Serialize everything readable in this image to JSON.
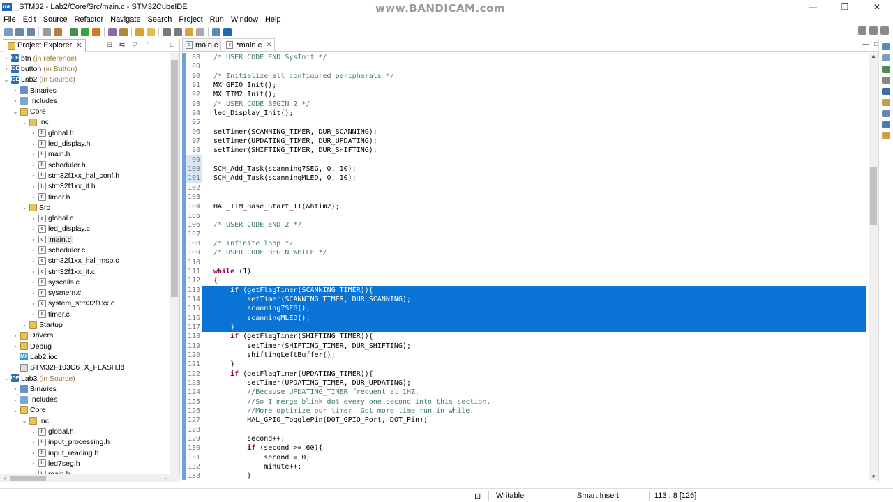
{
  "window": {
    "title": "_STM32 - Lab2/Core/Src/main.c - STM32CubeIDE",
    "logo_text": "IDE",
    "watermark": "www.BANDICAM.com",
    "minimize": "—",
    "maximize": "❐",
    "close": "✕"
  },
  "menu": [
    "File",
    "Edit",
    "Source",
    "Refactor",
    "Navigate",
    "Search",
    "Project",
    "Run",
    "Window",
    "Help"
  ],
  "explorer": {
    "title": "Project Explorer",
    "tree": [
      {
        "label": "btn",
        "suffix": "(in reference)",
        "icon": "project",
        "twisty": ">",
        "depth": 0
      },
      {
        "label": "button",
        "suffix": "(in Button)",
        "icon": "project",
        "twisty": ">",
        "depth": 0
      },
      {
        "label": "Lab2",
        "suffix": "(in Source)",
        "icon": "project",
        "twisty": "v",
        "depth": 0
      },
      {
        "label": "Binaries",
        "suffix": "",
        "icon": "bin",
        "twisty": ">",
        "depth": 1
      },
      {
        "label": "Includes",
        "suffix": "",
        "icon": "inc",
        "twisty": ">",
        "depth": 1
      },
      {
        "label": "Core",
        "suffix": "",
        "icon": "srcfolder",
        "twisty": "v",
        "depth": 1
      },
      {
        "label": "Inc",
        "suffix": "",
        "icon": "folder",
        "twisty": "v",
        "depth": 2
      },
      {
        "label": "global.h",
        "suffix": "",
        "icon": "file",
        "twisty": ">",
        "depth": 3
      },
      {
        "label": "led_display.h",
        "suffix": "",
        "icon": "file",
        "twisty": ">",
        "depth": 3
      },
      {
        "label": "main.h",
        "suffix": "",
        "icon": "file",
        "twisty": ">",
        "depth": 3
      },
      {
        "label": "scheduler.h",
        "suffix": "",
        "icon": "file",
        "twisty": ">",
        "depth": 3
      },
      {
        "label": "stm32f1xx_hal_conf.h",
        "suffix": "",
        "icon": "file",
        "twisty": ">",
        "depth": 3
      },
      {
        "label": "stm32f1xx_it.h",
        "suffix": "",
        "icon": "file",
        "twisty": ">",
        "depth": 3
      },
      {
        "label": "timer.h",
        "suffix": "",
        "icon": "file",
        "twisty": ">",
        "depth": 3
      },
      {
        "label": "Src",
        "suffix": "",
        "icon": "folder",
        "twisty": "v",
        "depth": 2
      },
      {
        "label": "global.c",
        "suffix": "",
        "icon": "file",
        "twisty": ">",
        "depth": 3
      },
      {
        "label": "led_display.c",
        "suffix": "",
        "icon": "file",
        "twisty": ">",
        "depth": 3
      },
      {
        "label": "main.c",
        "suffix": "",
        "icon": "file",
        "twisty": ">",
        "depth": 3,
        "selected": true
      },
      {
        "label": "scheduler.c",
        "suffix": "",
        "icon": "file",
        "twisty": ">",
        "depth": 3
      },
      {
        "label": "stm32f1xx_hal_msp.c",
        "suffix": "",
        "icon": "file",
        "twisty": ">",
        "depth": 3
      },
      {
        "label": "stm32f1xx_it.c",
        "suffix": "",
        "icon": "file",
        "twisty": ">",
        "depth": 3
      },
      {
        "label": "syscalls.c",
        "suffix": "",
        "icon": "file",
        "twisty": ">",
        "depth": 3
      },
      {
        "label": "sysmem.c",
        "suffix": "",
        "icon": "file",
        "twisty": ">",
        "depth": 3
      },
      {
        "label": "system_stm32f1xx.c",
        "suffix": "",
        "icon": "file",
        "twisty": ">",
        "depth": 3
      },
      {
        "label": "timer.c",
        "suffix": "",
        "icon": "file",
        "twisty": ">",
        "depth": 3
      },
      {
        "label": "Startup",
        "suffix": "",
        "icon": "folder",
        "twisty": ">",
        "depth": 2
      },
      {
        "label": "Drivers",
        "suffix": "",
        "icon": "srcfolder",
        "twisty": ">",
        "depth": 1
      },
      {
        "label": "Debug",
        "suffix": "",
        "icon": "folder",
        "twisty": ">",
        "depth": 1
      },
      {
        "label": "Lab2.ioc",
        "suffix": "",
        "icon": "ioc",
        "twisty": "",
        "depth": 1
      },
      {
        "label": "STM32F103C6TX_FLASH.ld",
        "suffix": "",
        "icon": "ld",
        "twisty": "",
        "depth": 1
      },
      {
        "label": "Lab3",
        "suffix": "(in Source)",
        "icon": "project",
        "twisty": "v",
        "depth": 0
      },
      {
        "label": "Binaries",
        "suffix": "",
        "icon": "bin",
        "twisty": ">",
        "depth": 1
      },
      {
        "label": "Includes",
        "suffix": "",
        "icon": "inc",
        "twisty": ">",
        "depth": 1
      },
      {
        "label": "Core",
        "suffix": "",
        "icon": "srcfolder",
        "twisty": "v",
        "depth": 1
      },
      {
        "label": "Inc",
        "suffix": "",
        "icon": "folder",
        "twisty": "v",
        "depth": 2
      },
      {
        "label": "global.h",
        "suffix": "",
        "icon": "file",
        "twisty": ">",
        "depth": 3
      },
      {
        "label": "input_processing.h",
        "suffix": "",
        "icon": "file",
        "twisty": ">",
        "depth": 3
      },
      {
        "label": "input_reading.h",
        "suffix": "",
        "icon": "file",
        "twisty": ">",
        "depth": 3
      },
      {
        "label": "led7seg.h",
        "suffix": "",
        "icon": "file",
        "twisty": ">",
        "depth": 3
      },
      {
        "label": "main.h",
        "suffix": "",
        "icon": "file",
        "twisty": ">",
        "depth": 3
      }
    ]
  },
  "editor": {
    "tabs": [
      {
        "label": "main.c",
        "active": false
      },
      {
        "label": "*main.c",
        "active": true
      }
    ],
    "lines": [
      {
        "n": "88",
        "text": "/* USER CODE END SysInit */",
        "type": "cm"
      },
      {
        "n": "89",
        "text": "",
        "type": ""
      },
      {
        "n": "90",
        "text": "/* Initialize all configured peripherals */",
        "type": "cm"
      },
      {
        "n": "91",
        "text": "MX_GPIO_Init();",
        "type": ""
      },
      {
        "n": "92",
        "text": "MX_TIM2_Init();",
        "type": ""
      },
      {
        "n": "93",
        "text": "/* USER CODE BEGIN 2 */",
        "type": "cm"
      },
      {
        "n": "94",
        "text": "led_Display_Init();",
        "type": ""
      },
      {
        "n": "95",
        "text": "",
        "type": ""
      },
      {
        "n": "96",
        "text": "setTimer(SCANNING_TIMER, DUR_SCANNING);",
        "type": ""
      },
      {
        "n": "97",
        "text": "setTimer(UPDATING_TIMER, DUR_UPDATING);",
        "type": ""
      },
      {
        "n": "98",
        "text": "setTimer(SHIFTING_TIMER, DUR_SHIFTING);",
        "type": ""
      },
      {
        "n": "99",
        "text": "",
        "type": "",
        "hl": true
      },
      {
        "n": "100",
        "text": "SCH_Add_Task(scanning7SEG, 0, 10);",
        "type": "",
        "hl": true
      },
      {
        "n": "101",
        "text": "SCH_Add_Task(scanningMLED, 0, 10);",
        "type": "",
        "hl": true
      },
      {
        "n": "102",
        "text": "",
        "type": ""
      },
      {
        "n": "103",
        "text": "",
        "type": ""
      },
      {
        "n": "104",
        "text": "HAL_TIM_Base_Start_IT(&htim2);",
        "type": ""
      },
      {
        "n": "105",
        "text": "",
        "type": ""
      },
      {
        "n": "106",
        "text": "/* USER CODE END 2 */",
        "type": "cm"
      },
      {
        "n": "107",
        "text": "",
        "type": ""
      },
      {
        "n": "108",
        "text": "/* Infinite loop */",
        "type": "cm"
      },
      {
        "n": "109",
        "text": "/* USER CODE BEGIN WHILE */",
        "type": "cm"
      },
      {
        "n": "110",
        "text": "",
        "type": ""
      },
      {
        "n": "111",
        "text": "while (1)",
        "type": "kw_while"
      },
      {
        "n": "112",
        "text": "{",
        "type": ""
      },
      {
        "n": "113",
        "text": "    if (getFlagTimer(SCANNING_TIMER)){",
        "type": "kw_if",
        "sel": true
      },
      {
        "n": "114",
        "text": "        setTimer(SCANNING_TIMER, DUR_SCANNING);",
        "type": "",
        "sel": true
      },
      {
        "n": "115",
        "text": "        scanning7SEG();",
        "type": "",
        "sel": true
      },
      {
        "n": "116",
        "text": "        scanningMLED();",
        "type": "",
        "sel": true
      },
      {
        "n": "117",
        "text": "    }",
        "type": "",
        "sel": true
      },
      {
        "n": "118",
        "text": "    if (getFlagTimer(SHIFTING_TIMER)){",
        "type": "kw_if"
      },
      {
        "n": "119",
        "text": "        setTimer(SHIFTING_TIMER, DUR_SHIFTING);",
        "type": ""
      },
      {
        "n": "120",
        "text": "        shiftingLeftBuffer();",
        "type": ""
      },
      {
        "n": "121",
        "text": "    }",
        "type": ""
      },
      {
        "n": "122",
        "text": "    if (getFlagTimer(UPDATING_TIMER)){",
        "type": "kw_if"
      },
      {
        "n": "123",
        "text": "        setTimer(UPDATING_TIMER, DUR_UPDATING);",
        "type": ""
      },
      {
        "n": "124",
        "text": "        //Because UPDATING_TIMER frequent at 1HZ.",
        "type": "cm"
      },
      {
        "n": "125",
        "text": "        //So I merge blink dot every one second into this section.",
        "type": "cm"
      },
      {
        "n": "126",
        "text": "        //More optimize our timer. Got more time run in while.",
        "type": "cm"
      },
      {
        "n": "127",
        "text": "        HAL_GPIO_TogglePin(DOT_GPIO_Port, DOT_Pin);",
        "type": ""
      },
      {
        "n": "128",
        "text": "",
        "type": ""
      },
      {
        "n": "129",
        "text": "        second++;",
        "type": ""
      },
      {
        "n": "130",
        "text": "        if (second >= 60){",
        "type": "kw_if"
      },
      {
        "n": "131",
        "text": "            second = 0;",
        "type": ""
      },
      {
        "n": "132",
        "text": "            minute++;",
        "type": ""
      },
      {
        "n": "133",
        "text": "        }",
        "type": ""
      }
    ]
  },
  "status": {
    "mode": "Writable",
    "insert": "Smart Insert",
    "position": "113 : 8 [126]"
  }
}
